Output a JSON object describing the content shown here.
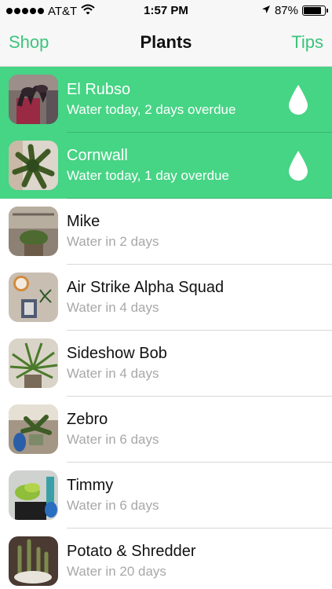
{
  "status_bar": {
    "carrier": "AT&T",
    "time": "1:57 PM",
    "battery_percent": "87%",
    "battery_level": 0.87,
    "icons": [
      "signal-dots-icon",
      "wifi-icon",
      "location-arrow-icon",
      "battery-icon"
    ]
  },
  "nav": {
    "left_label": "Shop",
    "title": "Plants",
    "right_label": "Tips"
  },
  "colors": {
    "accent": "#3cc47c",
    "overdue_row": "#46d485",
    "subtitle_gray": "#a8a8a8"
  },
  "plants": [
    {
      "name": "El Rubso",
      "status": "Water today, 2 days overdue",
      "overdue": true,
      "icon": "water-drop-icon"
    },
    {
      "name": "Cornwall",
      "status": "Water today, 1 day overdue",
      "overdue": true,
      "icon": "water-drop-icon"
    },
    {
      "name": "Mike",
      "status": "Water in 2 days",
      "overdue": false
    },
    {
      "name": "Air Strike Alpha Squad",
      "status": "Water in 4 days",
      "overdue": false
    },
    {
      "name": "Sideshow Bob",
      "status": "Water in 4 days",
      "overdue": false
    },
    {
      "name": "Zebro",
      "status": "Water in 6 days",
      "overdue": false
    },
    {
      "name": "Timmy",
      "status": "Water in 6 days",
      "overdue": false
    },
    {
      "name": "Potato & Shredder",
      "status": "Water in 20 days",
      "overdue": false
    }
  ]
}
